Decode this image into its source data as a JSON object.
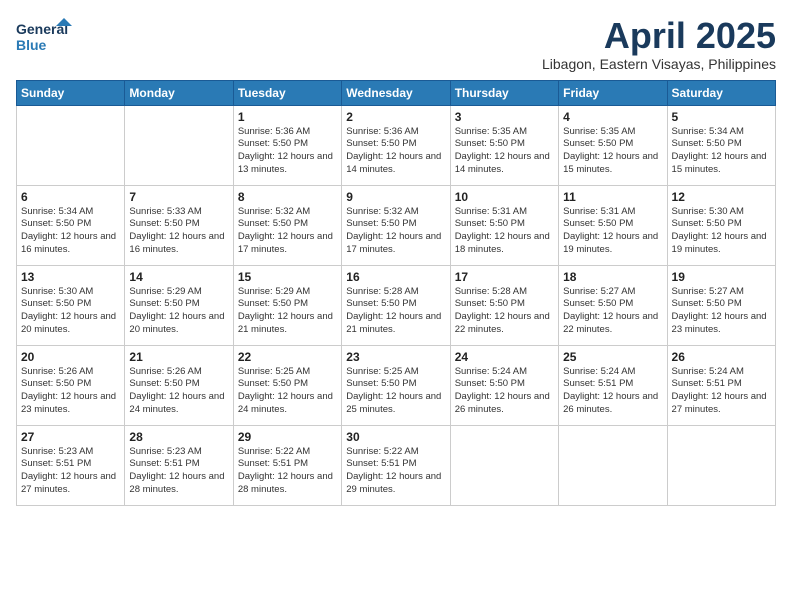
{
  "logo": {
    "line1": "General",
    "line2": "Blue"
  },
  "title": "April 2025",
  "location": "Libagon, Eastern Visayas, Philippines",
  "days_header": [
    "Sunday",
    "Monday",
    "Tuesday",
    "Wednesday",
    "Thursday",
    "Friday",
    "Saturday"
  ],
  "weeks": [
    [
      null,
      null,
      {
        "day": 1,
        "sunrise": "5:36 AM",
        "sunset": "5:50 PM",
        "daylight": "12 hours and 13 minutes."
      },
      {
        "day": 2,
        "sunrise": "5:36 AM",
        "sunset": "5:50 PM",
        "daylight": "12 hours and 14 minutes."
      },
      {
        "day": 3,
        "sunrise": "5:35 AM",
        "sunset": "5:50 PM",
        "daylight": "12 hours and 14 minutes."
      },
      {
        "day": 4,
        "sunrise": "5:35 AM",
        "sunset": "5:50 PM",
        "daylight": "12 hours and 15 minutes."
      },
      {
        "day": 5,
        "sunrise": "5:34 AM",
        "sunset": "5:50 PM",
        "daylight": "12 hours and 15 minutes."
      }
    ],
    [
      {
        "day": 6,
        "sunrise": "5:34 AM",
        "sunset": "5:50 PM",
        "daylight": "12 hours and 16 minutes."
      },
      {
        "day": 7,
        "sunrise": "5:33 AM",
        "sunset": "5:50 PM",
        "daylight": "12 hours and 16 minutes."
      },
      {
        "day": 8,
        "sunrise": "5:32 AM",
        "sunset": "5:50 PM",
        "daylight": "12 hours and 17 minutes."
      },
      {
        "day": 9,
        "sunrise": "5:32 AM",
        "sunset": "5:50 PM",
        "daylight": "12 hours and 17 minutes."
      },
      {
        "day": 10,
        "sunrise": "5:31 AM",
        "sunset": "5:50 PM",
        "daylight": "12 hours and 18 minutes."
      },
      {
        "day": 11,
        "sunrise": "5:31 AM",
        "sunset": "5:50 PM",
        "daylight": "12 hours and 19 minutes."
      },
      {
        "day": 12,
        "sunrise": "5:30 AM",
        "sunset": "5:50 PM",
        "daylight": "12 hours and 19 minutes."
      }
    ],
    [
      {
        "day": 13,
        "sunrise": "5:30 AM",
        "sunset": "5:50 PM",
        "daylight": "12 hours and 20 minutes."
      },
      {
        "day": 14,
        "sunrise": "5:29 AM",
        "sunset": "5:50 PM",
        "daylight": "12 hours and 20 minutes."
      },
      {
        "day": 15,
        "sunrise": "5:29 AM",
        "sunset": "5:50 PM",
        "daylight": "12 hours and 21 minutes."
      },
      {
        "day": 16,
        "sunrise": "5:28 AM",
        "sunset": "5:50 PM",
        "daylight": "12 hours and 21 minutes."
      },
      {
        "day": 17,
        "sunrise": "5:28 AM",
        "sunset": "5:50 PM",
        "daylight": "12 hours and 22 minutes."
      },
      {
        "day": 18,
        "sunrise": "5:27 AM",
        "sunset": "5:50 PM",
        "daylight": "12 hours and 22 minutes."
      },
      {
        "day": 19,
        "sunrise": "5:27 AM",
        "sunset": "5:50 PM",
        "daylight": "12 hours and 23 minutes."
      }
    ],
    [
      {
        "day": 20,
        "sunrise": "5:26 AM",
        "sunset": "5:50 PM",
        "daylight": "12 hours and 23 minutes."
      },
      {
        "day": 21,
        "sunrise": "5:26 AM",
        "sunset": "5:50 PM",
        "daylight": "12 hours and 24 minutes."
      },
      {
        "day": 22,
        "sunrise": "5:25 AM",
        "sunset": "5:50 PM",
        "daylight": "12 hours and 24 minutes."
      },
      {
        "day": 23,
        "sunrise": "5:25 AM",
        "sunset": "5:50 PM",
        "daylight": "12 hours and 25 minutes."
      },
      {
        "day": 24,
        "sunrise": "5:24 AM",
        "sunset": "5:50 PM",
        "daylight": "12 hours and 26 minutes."
      },
      {
        "day": 25,
        "sunrise": "5:24 AM",
        "sunset": "5:51 PM",
        "daylight": "12 hours and 26 minutes."
      },
      {
        "day": 26,
        "sunrise": "5:24 AM",
        "sunset": "5:51 PM",
        "daylight": "12 hours and 27 minutes."
      }
    ],
    [
      {
        "day": 27,
        "sunrise": "5:23 AM",
        "sunset": "5:51 PM",
        "daylight": "12 hours and 27 minutes."
      },
      {
        "day": 28,
        "sunrise": "5:23 AM",
        "sunset": "5:51 PM",
        "daylight": "12 hours and 28 minutes."
      },
      {
        "day": 29,
        "sunrise": "5:22 AM",
        "sunset": "5:51 PM",
        "daylight": "12 hours and 28 minutes."
      },
      {
        "day": 30,
        "sunrise": "5:22 AM",
        "sunset": "5:51 PM",
        "daylight": "12 hours and 29 minutes."
      },
      null,
      null,
      null
    ]
  ]
}
